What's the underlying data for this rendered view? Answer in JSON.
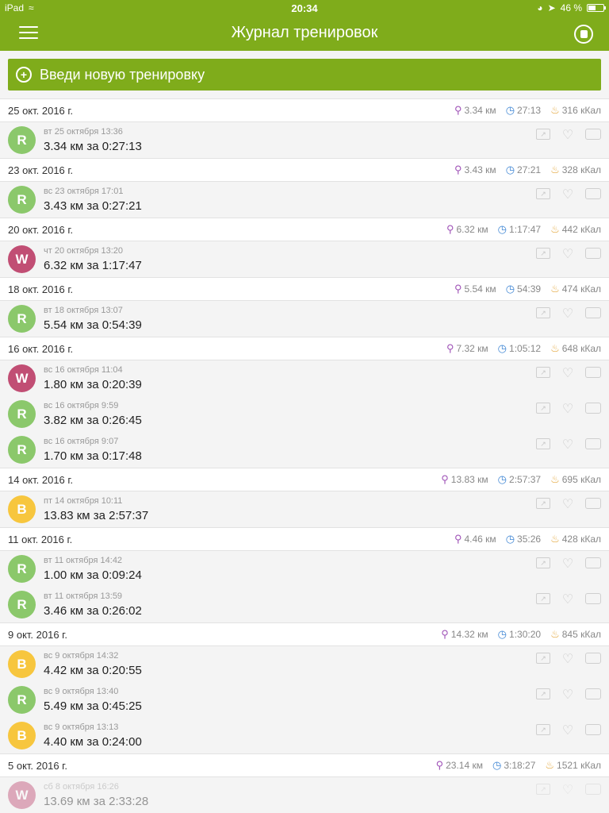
{
  "status": {
    "device": "iPad",
    "time": "20:34",
    "battery": "46 %",
    "battery_level": 0.46
  },
  "header": {
    "title": "Журнал тренировок"
  },
  "new_workout": {
    "label": "Введи новую тренировку"
  },
  "days": [
    {
      "date": "25 окт. 2016 г.",
      "distance": "3.34 км",
      "duration": "27:13",
      "calories": "316 кКал",
      "workouts": [
        {
          "type": "run",
          "when": "вт 25 октября 13:36",
          "text": "3.34 км за 0:27:13"
        }
      ]
    },
    {
      "date": "23 окт. 2016 г.",
      "distance": "3.43 км",
      "duration": "27:21",
      "calories": "328 кКал",
      "workouts": [
        {
          "type": "run",
          "when": "вс 23 октября 17:01",
          "text": "3.43 км за 0:27:21"
        }
      ]
    },
    {
      "date": "20 окт. 2016 г.",
      "distance": "6.32 км",
      "duration": "1:17:47",
      "calories": "442 кКал",
      "workouts": [
        {
          "type": "walk",
          "when": "чт 20 октября 13:20",
          "text": "6.32 км за 1:17:47"
        }
      ]
    },
    {
      "date": "18 окт. 2016 г.",
      "distance": "5.54 км",
      "duration": "54:39",
      "calories": "474 кКал",
      "workouts": [
        {
          "type": "run",
          "when": "вт 18 октября 13:07",
          "text": "5.54 км за 0:54:39"
        }
      ]
    },
    {
      "date": "16 окт. 2016 г.",
      "distance": "7.32 км",
      "duration": "1:05:12",
      "calories": "648 кКал",
      "workouts": [
        {
          "type": "walk",
          "when": "вс 16 октября 11:04",
          "text": "1.80 км за 0:20:39"
        },
        {
          "type": "run",
          "when": "вс 16 октября 9:59",
          "text": "3.82 км за 0:26:45"
        },
        {
          "type": "run",
          "when": "вс 16 октября 9:07",
          "text": "1.70 км за 0:17:48"
        }
      ]
    },
    {
      "date": "14 окт. 2016 г.",
      "distance": "13.83 км",
      "duration": "2:57:37",
      "calories": "695 кКал",
      "workouts": [
        {
          "type": "bike",
          "when": "пт 14 октября 10:11",
          "text": "13.83 км за 2:57:37"
        }
      ]
    },
    {
      "date": "11 окт. 2016 г.",
      "distance": "4.46 км",
      "duration": "35:26",
      "calories": "428 кКал",
      "workouts": [
        {
          "type": "run",
          "when": "вт 11 октября 14:42",
          "text": "1.00 км за 0:09:24"
        },
        {
          "type": "run",
          "when": "вт 11 октября 13:59",
          "text": "3.46 км за 0:26:02"
        }
      ]
    },
    {
      "date": "9 окт. 2016 г.",
      "distance": "14.32 км",
      "duration": "1:30:20",
      "calories": "845 кКал",
      "workouts": [
        {
          "type": "bike",
          "when": "вс 9 октября 14:32",
          "text": "4.42 км за 0:20:55"
        },
        {
          "type": "run",
          "when": "вс 9 октября 13:40",
          "text": "5.49 км за 0:45:25"
        },
        {
          "type": "bike",
          "when": "вс 9 октября 13:13",
          "text": "4.40 км за 0:24:00"
        }
      ]
    },
    {
      "date": "5 окт. 2016 г.",
      "distance": "23.14 км",
      "duration": "3:18:27",
      "calories": "1521 кКал",
      "workouts": [
        {
          "type": "walk",
          "when": "сб 8 октября 16:26",
          "text": "13.69 км за 2:33:28",
          "faded": true
        }
      ]
    }
  ]
}
